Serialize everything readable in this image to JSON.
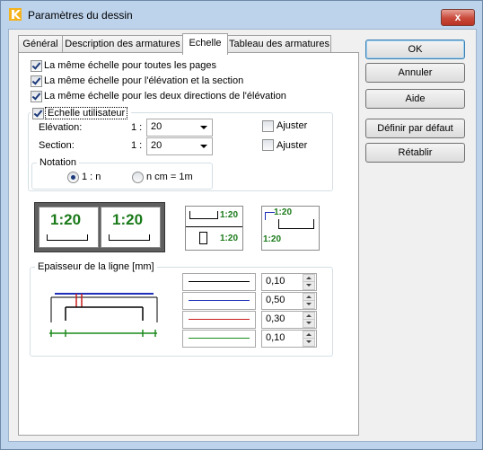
{
  "window": {
    "title": "Paramètres du dessin",
    "close_label": "x"
  },
  "tabs": [
    {
      "label": "Général",
      "active": false
    },
    {
      "label": "Description des armatures",
      "active": false
    },
    {
      "label": "Echelle",
      "active": true
    },
    {
      "label": "Tableau des armatures",
      "active": false
    }
  ],
  "options": {
    "same_scale_all_pages": {
      "label": "La même échelle pour toutes les pages",
      "checked": true
    },
    "same_scale_elev_section": {
      "label": "La même échelle pour l'élévation et la section",
      "checked": true
    },
    "same_scale_both_dirs": {
      "label": "La même échelle pour les deux directions de l'élévation",
      "checked": true
    }
  },
  "user_scale": {
    "label": "Echelle utilisateur",
    "checked": true,
    "elevation": {
      "label": "Elévation:",
      "ratio": "1 :",
      "value": "20",
      "adjust_label": "Ajuster",
      "adjust_checked": false
    },
    "section": {
      "label": "Section:",
      "ratio": "1 :",
      "value": "20",
      "adjust_label": "Ajuster",
      "adjust_checked": false
    },
    "notation": {
      "label": "Notation",
      "options": [
        {
          "label": "1 : n",
          "selected": true
        },
        {
          "label": "n cm = 1m",
          "selected": false
        }
      ]
    }
  },
  "layout_previews": {
    "side_by_side": [
      "1:20",
      "1:20"
    ],
    "stacked": [
      "1:20",
      "1:20"
    ],
    "corner": [
      "1:20",
      "1:20"
    ]
  },
  "line_thickness": {
    "label": "Epaisseur de la ligne [mm]",
    "rows": [
      {
        "color": "#000000",
        "value": "0,10"
      },
      {
        "color": "#1f2fb8",
        "value": "0,50"
      },
      {
        "color": "#c81e1e",
        "value": "0,30"
      },
      {
        "color": "#1c8a1c",
        "value": "0,10"
      }
    ]
  },
  "buttons": {
    "ok": "OK",
    "cancel": "Annuler",
    "help": "Aide",
    "set_default": "Définir par défaut",
    "restore": "Rétablir"
  },
  "colors": {
    "scale_text": "#1a7a1a",
    "frame": "#bdd3ec"
  }
}
